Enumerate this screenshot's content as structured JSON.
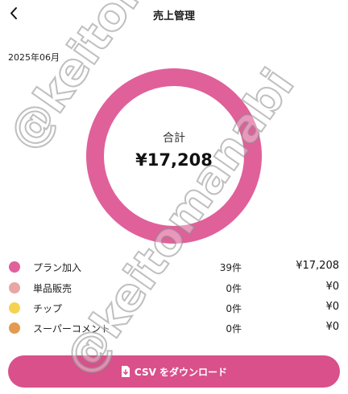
{
  "header": {
    "title": "売上管理"
  },
  "period": "2025年06月",
  "summary": {
    "label": "合計",
    "amount": "¥17,208"
  },
  "categories": [
    {
      "label": "プラン加入",
      "count": "39件",
      "amount": "¥17,208",
      "color": "#e0609a",
      "value": 17208
    },
    {
      "label": "単品販売",
      "count": "0件",
      "amount": "¥0",
      "color": "#e8a6a6",
      "value": 0
    },
    {
      "label": "チップ",
      "count": "0件",
      "amount": "¥0",
      "color": "#f5d350",
      "value": 0
    },
    {
      "label": "スーパーコメント",
      "count": "0件",
      "amount": "¥0",
      "color": "#e49a50",
      "value": 0
    }
  ],
  "actions": {
    "download_label": "CSV をダウンロード"
  },
  "watermark": {
    "text": "@keitomanabi"
  },
  "colors": {
    "accent": "#d9508a",
    "ring": "#e0609a"
  },
  "icons": {
    "back": "chevron-left-icon",
    "download": "file-download-icon"
  }
}
